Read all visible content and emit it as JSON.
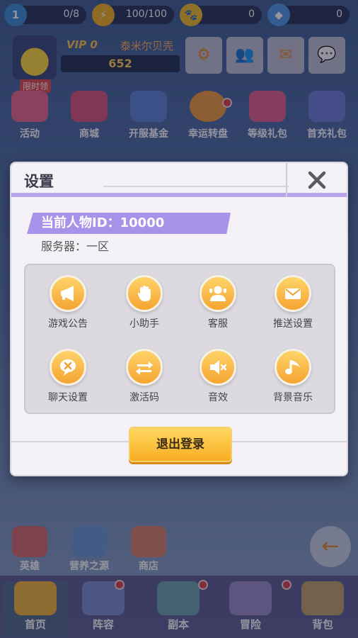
{
  "top_resources": [
    {
      "icon": "level-badge-icon",
      "label": "1",
      "value": "0/8"
    },
    {
      "icon": "energy-lightning-icon",
      "value": "100/100"
    },
    {
      "icon": "paw-coin-icon",
      "value": "0"
    },
    {
      "icon": "diamond-gem-icon",
      "value": "0"
    }
  ],
  "profile": {
    "vip": "VIP 0",
    "player_name": "泰米尔贝壳",
    "power": "652"
  },
  "activities": [
    {
      "label": "活动",
      "icon": "activity-star-icon"
    },
    {
      "label": "商城",
      "icon": "shop-gift-icon"
    },
    {
      "label": "开服基金",
      "icon": "fund-chest-icon"
    },
    {
      "label": "幸运转盘",
      "icon": "lucky-wheel-icon"
    },
    {
      "label": "等级礼包",
      "icon": "level-gift-icon"
    },
    {
      "label": "首充礼包",
      "icon": "first-charge-gift-icon"
    }
  ],
  "activity_badge": "限时领",
  "bottom_icons": [
    {
      "label": "英雄",
      "icon": "hero-card-icon"
    },
    {
      "label": "营养之源",
      "icon": "nutrition-bottle-icon"
    },
    {
      "label": "商店",
      "icon": "store-icon"
    }
  ],
  "nav_tabs": [
    {
      "label": "首页",
      "icon": "home-tab-icon"
    },
    {
      "label": "阵容",
      "icon": "lineup-tab-icon"
    },
    {
      "label": "副本",
      "icon": "dungeon-tab-icon"
    },
    {
      "label": "冒险",
      "icon": "adventure-tab-icon"
    },
    {
      "label": "背包",
      "icon": "backpack-tab-icon"
    }
  ],
  "dialog": {
    "title": "设置",
    "character_id": "当前人物ID：10000",
    "server": "服务器：一区",
    "options": [
      {
        "label": "游戏公告",
        "icon": "megaphone-icon"
      },
      {
        "label": "小助手",
        "icon": "hand-icon"
      },
      {
        "label": "客服",
        "icon": "customer-service-icon"
      },
      {
        "label": "推送设置",
        "icon": "envelope-icon"
      },
      {
        "label": "聊天设置",
        "icon": "chat-bubble-icon"
      },
      {
        "label": "激活码",
        "icon": "swap-arrows-icon"
      },
      {
        "label": "音效",
        "icon": "speaker-mute-icon"
      },
      {
        "label": "背景音乐",
        "icon": "music-note-icon"
      }
    ],
    "logout_label": "退出登录"
  },
  "colors": {
    "accent_purple": "#a893ea",
    "button_orange": "#f8ad22",
    "icon_orange": "#f5a431",
    "notice_red": "#d8424a"
  }
}
